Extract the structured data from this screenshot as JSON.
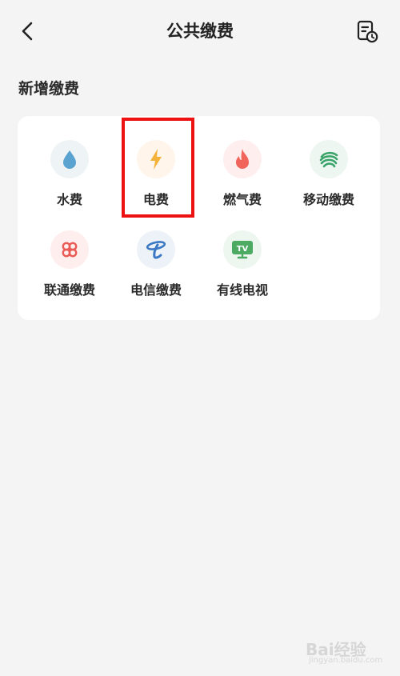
{
  "header": {
    "title": "公共缴费",
    "back_icon": "chevron-left-icon",
    "record_icon": "bill-history-icon"
  },
  "section": {
    "title": "新增缴费"
  },
  "items": [
    {
      "label": "水费",
      "icon": "water-drop-icon",
      "bg": "#eef3f6",
      "color": "#5aa2cf"
    },
    {
      "label": "电费",
      "icon": "lightning-icon",
      "bg": "#fff5ea",
      "color": "#f5b23a"
    },
    {
      "label": "燃气费",
      "icon": "flame-icon",
      "bg": "#feeeee",
      "color": "#f0645a"
    },
    {
      "label": "移动缴费",
      "icon": "china-mobile-icon",
      "bg": "#edf6f1",
      "color": "#3aa36a"
    },
    {
      "label": "联通缴费",
      "icon": "china-unicom-icon",
      "bg": "#feeeee",
      "color": "#ea5a55"
    },
    {
      "label": "电信缴费",
      "icon": "china-telecom-icon",
      "bg": "#edf2f8",
      "color": "#3a78c4"
    },
    {
      "label": "有线电视",
      "icon": "tv-icon",
      "bg": "#edf6ef",
      "color": "#4caa63"
    }
  ],
  "watermark": {
    "text": "Bai经验",
    "sub": "jingyan.baidu.com"
  }
}
